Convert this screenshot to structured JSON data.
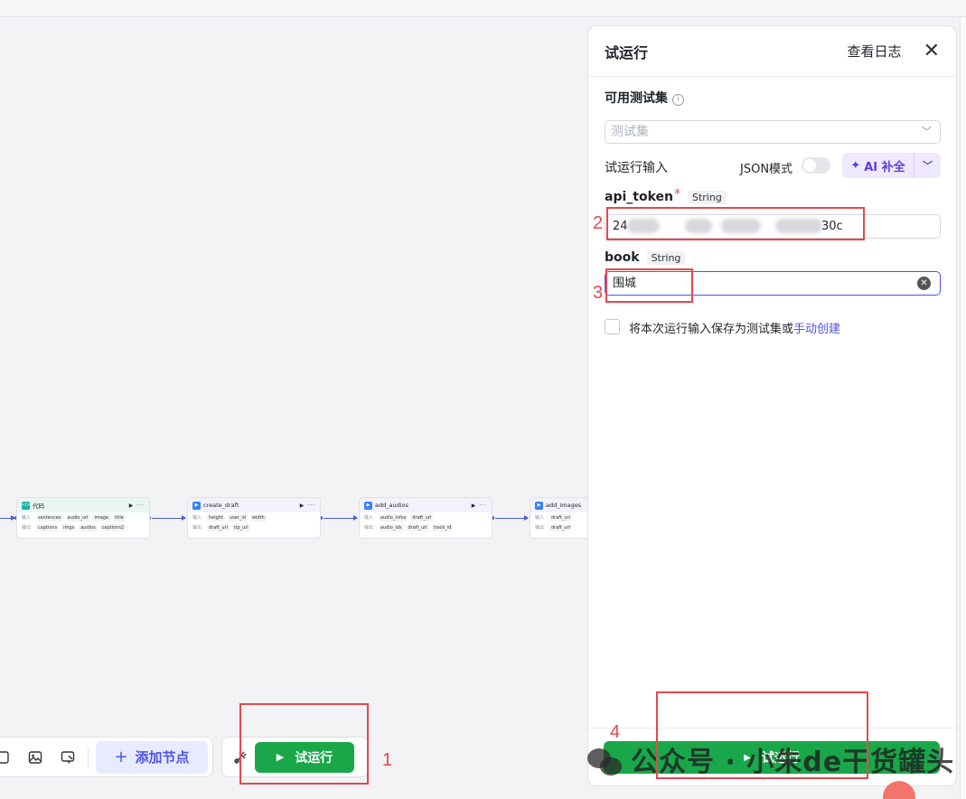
{
  "canvas": {
    "nodes": [
      {
        "title": "代码",
        "icon": "code-icon",
        "icon_color": "#18b4a0",
        "head_bg": "#e9f7f3",
        "input_label": "输入",
        "inputs": [
          "sentences",
          "audio_url",
          "image",
          "title"
        ],
        "output_label": "输出",
        "outputs": [
          "captions",
          "imgs",
          "audios",
          "captions2"
        ]
      },
      {
        "title": "create_draft",
        "icon": "plugin-icon",
        "icon_color": "#3b82f6",
        "head_bg": "#f3f1fb",
        "input_label": "输入",
        "inputs": [
          "height",
          "user_id",
          "width"
        ],
        "output_label": "输出",
        "outputs": [
          "draft_url",
          "tip_url"
        ]
      },
      {
        "title": "add_audios",
        "icon": "plugin-icon",
        "icon_color": "#3b82f6",
        "head_bg": "#f3f1fb",
        "input_label": "输入",
        "inputs": [
          "audio_infos",
          "draft_url"
        ],
        "output_label": "输出",
        "outputs": [
          "audio_ids",
          "draft_url",
          "track_id"
        ]
      },
      {
        "title": "add_images",
        "icon": "plugin-icon",
        "icon_color": "#3b82f6",
        "head_bg": "#f3f1fb",
        "input_label": "输入",
        "inputs": [
          "draft_url"
        ],
        "output_label": "输出",
        "outputs": [
          "draft_url"
        ]
      }
    ]
  },
  "toolbar": {
    "add_node_label": "添加节点",
    "run_label": "试运行"
  },
  "panel": {
    "title": "试运行",
    "view_logs": "查看日志",
    "testset_label": "可用测试集",
    "testset_placeholder": "测试集",
    "run_input_label": "试运行输入",
    "json_mode_label": "JSON模式",
    "ai_fill_label": "AI 补全",
    "fields": [
      {
        "name": "api_token",
        "required": true,
        "type": "String",
        "value_start": "24",
        "value_end": "30c"
      },
      {
        "name": "book",
        "required": false,
        "type": "String",
        "value": "围城"
      }
    ],
    "save_text": "将本次运行输入保存为测试集或",
    "manual_create_link": "手动创建",
    "footer_run_label": "试运行"
  },
  "annotations": {
    "numbers": [
      "1",
      "2",
      "3",
      "4"
    ],
    "color": "#e5484d"
  },
  "watermark": {
    "text": "公众号 · 小朱de干货罐头"
  },
  "colors": {
    "accent": "#4d53e8",
    "run_green": "#19a74a"
  }
}
